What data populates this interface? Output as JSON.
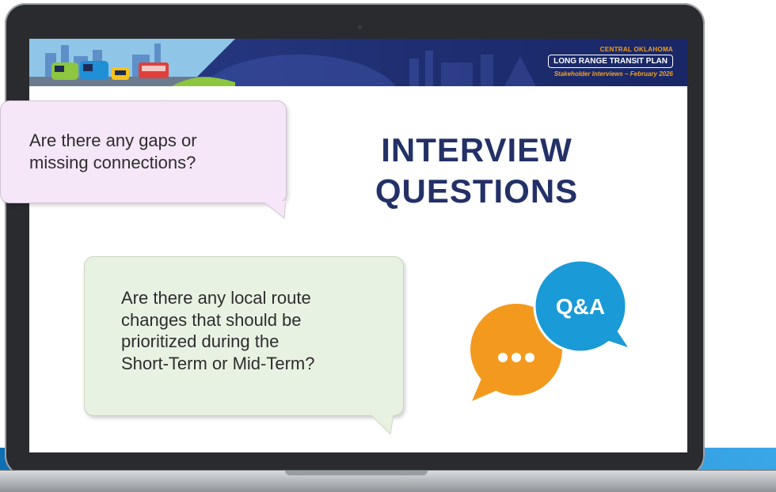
{
  "banner": {
    "org_name": "CENTRAL OKLAHOMA",
    "plan_title": "LONG RANGE TRANSIT PLAN",
    "subtitle": "Stakeholder Interviews – February 2026"
  },
  "slide": {
    "heading_line1": "INTERVIEW",
    "heading_line2": "QUESTIONS"
  },
  "bubbles": [
    {
      "lines": [
        "Are there any gaps or",
        "missing connections?"
      ]
    },
    {
      "lines": [
        "Are there any local route",
        "changes that should be",
        "prioritized during the",
        "Short-Term or Mid-Term?"
      ]
    }
  ],
  "qa_icon": {
    "label": "Q&A",
    "icon": "chat-bubbles-qa-icon",
    "colors": {
      "blue": "#1a9ad6",
      "orange": "#f39a1e"
    }
  },
  "colors": {
    "heading": "#233167",
    "banner": "#2b3d8d",
    "accent_orange": "#f6a01a",
    "bubble_pink": "#f5e6f8",
    "bubble_green": "#e8f2e2"
  }
}
